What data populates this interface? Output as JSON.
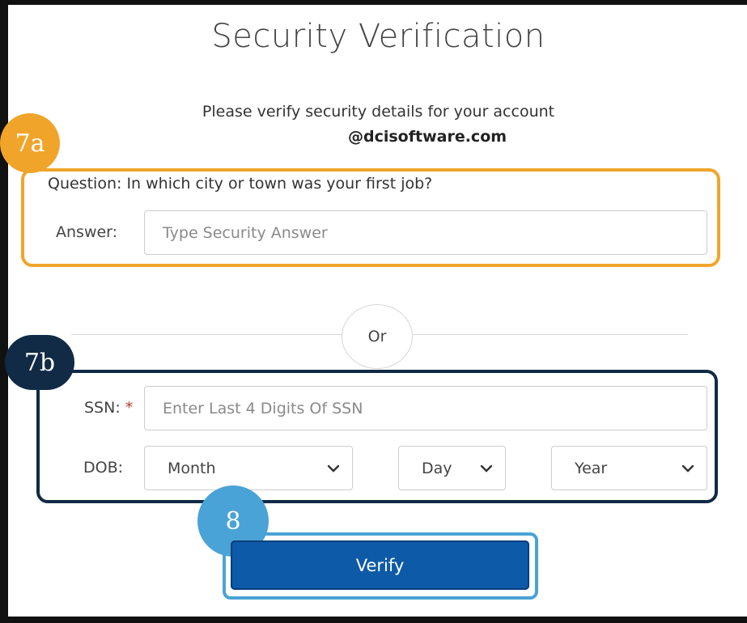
{
  "header": {
    "title": "Security Verification",
    "subtitle": "Please verify security details for your account",
    "account": "@dcisoftware.com"
  },
  "callouts": {
    "a": "7a",
    "b": "7b",
    "c": "8"
  },
  "question": {
    "label": "Question:",
    "text": "In which city or town was your first job?",
    "answer_label": "Answer:",
    "answer_placeholder": "Type Security Answer"
  },
  "divider": {
    "or_label": "Or"
  },
  "ssn": {
    "label": "SSN:",
    "required_mark": "*",
    "placeholder": "Enter Last 4 Digits Of SSN"
  },
  "dob": {
    "label": "DOB:",
    "month": "Month",
    "day": "Day",
    "year": "Year"
  },
  "actions": {
    "verify_label": "Verify"
  },
  "colors": {
    "callout_7a": "#f0a52a",
    "callout_7b": "#112a45",
    "callout_8": "#4aa3d6",
    "button": "#0d5aa8"
  }
}
